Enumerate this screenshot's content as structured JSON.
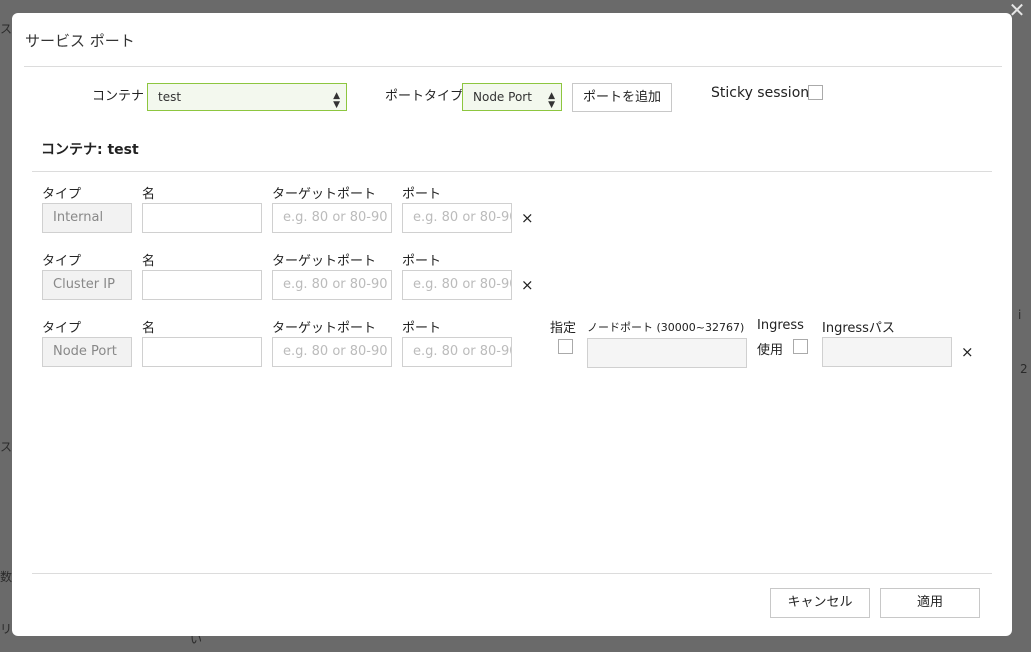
{
  "dialog": {
    "title": "サービス ポート",
    "close_icon": "close-icon"
  },
  "toolbar": {
    "container_label": "コンテナ :",
    "container_value": "test",
    "port_type_label": "ポートタイプ :",
    "port_type_value": "Node Port",
    "add_port_label": "ポートを追加",
    "sticky_session_label": "Sticky session"
  },
  "section": {
    "title": "コンテナ: test"
  },
  "columns": {
    "type": "タイプ",
    "name": "名",
    "target_port": "ターゲットポート",
    "port": "ポート",
    "specify": "指定",
    "node_port": "ノードポート (30000~32767)",
    "ingress": "Ingress",
    "ingress_use": "使用",
    "ingress_path": "Ingressパス"
  },
  "rows": [
    {
      "type": "Internal",
      "name": "",
      "target_port_placeholder": "e.g. 80 or 80-90",
      "port_placeholder": "e.g. 80 or 80-90",
      "remove": "×"
    },
    {
      "type": "Cluster IP",
      "name": "",
      "target_port_placeholder": "e.g. 80 or 80-90",
      "port_placeholder": "e.g. 80 or 80-90",
      "remove": "×"
    },
    {
      "type": "Node Port",
      "name": "",
      "target_port_placeholder": "e.g. 80 or 80-90",
      "port_placeholder": "e.g. 80 or 80-90",
      "remove": "×"
    }
  ],
  "footer": {
    "cancel_label": "キャンセル",
    "apply_label": "適用"
  }
}
